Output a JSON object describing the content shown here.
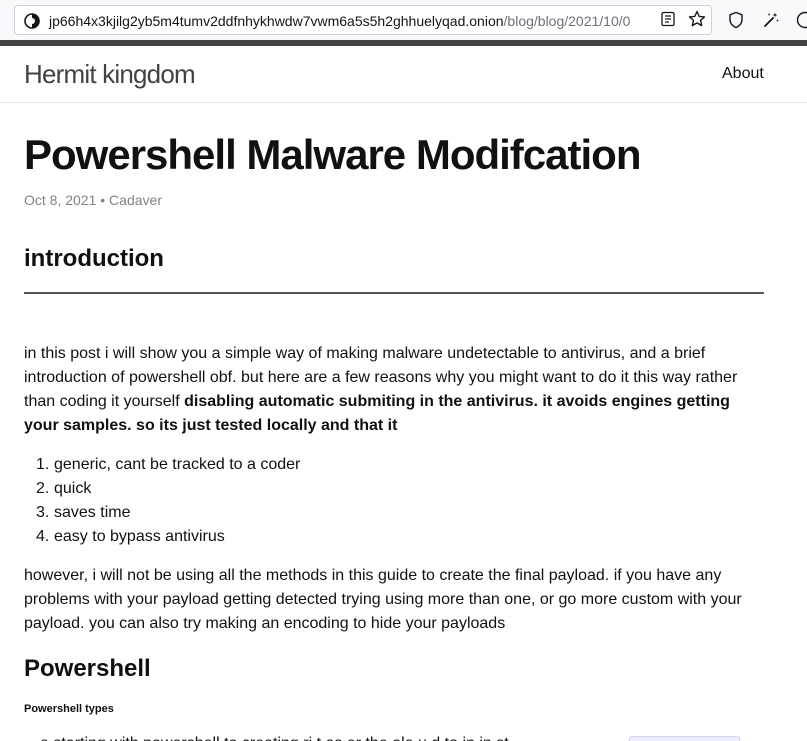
{
  "browser": {
    "url_domain": "jp66h4x3kjilg2yb5m4tumv2ddfnhykhwdw7vwm6a5s5h2ghhuelyqad.onion",
    "url_path": "/blog/blog/2021/10/0"
  },
  "header": {
    "site_title": "Hermit kingdom",
    "nav_about": "About"
  },
  "post": {
    "title": "Powershell Malware Modifcation",
    "meta": "Oct 8, 2021 • Cadaver",
    "section_intro": "introduction",
    "para1_plain": "in this post i will show you a simple way of making malware undetectable to antivirus, and a brief introduction of powershell obf. but here are a few reasons why you might want to do it this way rather than coding it yourself ",
    "para1_bold": "disabling automatic submiting in the antivirus. it avoids engines getting your samples. so its just tested locally and that it",
    "list": [
      {
        "num": "1.",
        "text": "generic, cant be tracked to a coder"
      },
      {
        "num": "2.",
        "text": "quick"
      },
      {
        "num": "3.",
        "text": "saves time"
      },
      {
        "num": "4.",
        "text": "easy to bypass antivirus"
      }
    ],
    "para2": "however, i will not be using all the methods in this guide to create the final payload. if you have any problems with your payload getting detected trying using more than one, or go more custom with your payload. you can also try making an encoding to hide your payloads",
    "section_powershell": "Powershell",
    "subsection_types": "Powershell types",
    "cut_line": "…e starting with powershell to creating ri   t as er the   ole u   d to   in   in   st"
  },
  "colors": {
    "accent_bar": "#424242",
    "site_title": "#424242",
    "meta": "#828282"
  }
}
